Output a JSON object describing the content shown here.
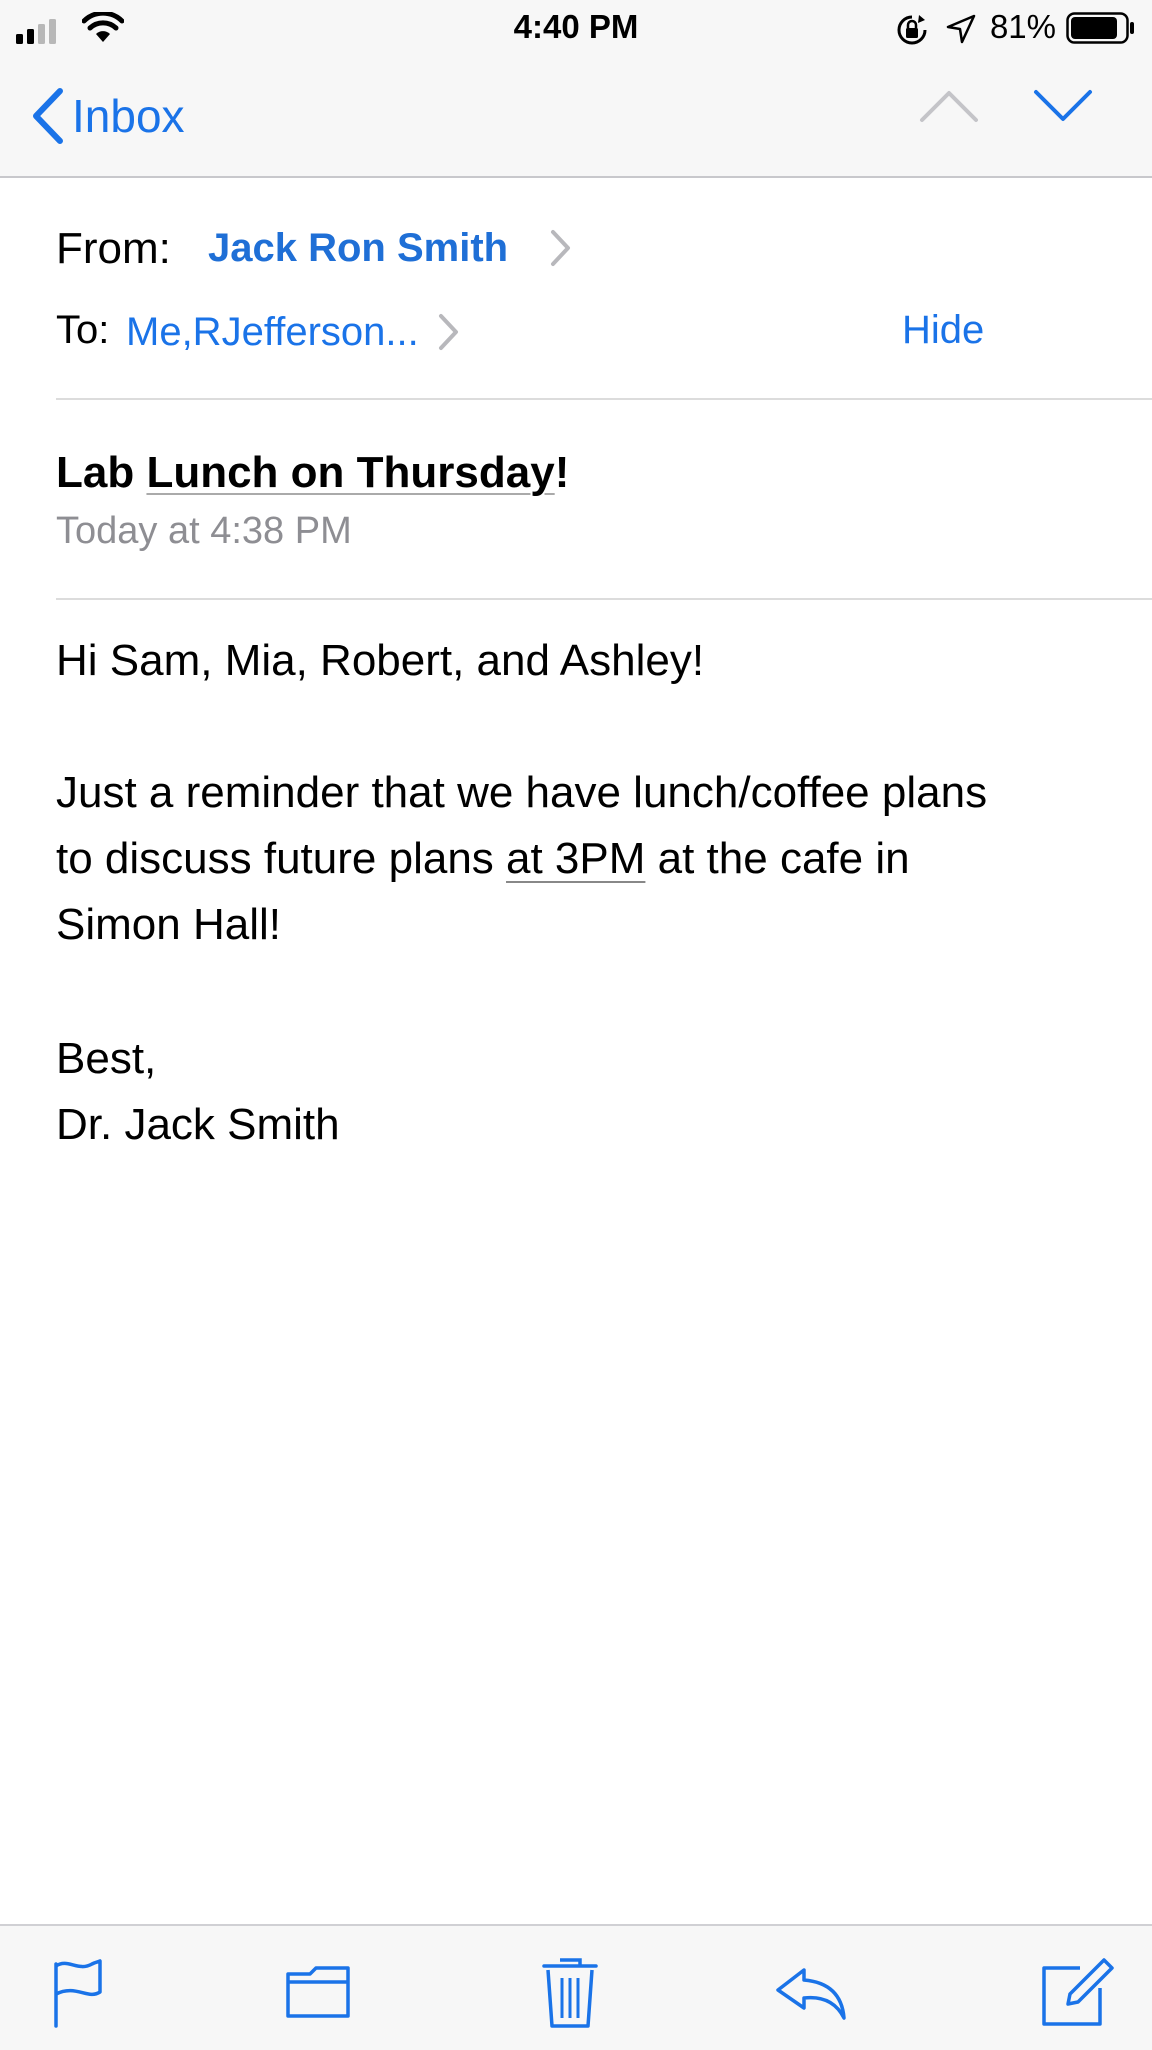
{
  "status_bar": {
    "time": "4:40 PM",
    "battery_percent": "81%",
    "icons": [
      "signal-icon",
      "wifi-icon",
      "rotation-lock-icon",
      "location-icon",
      "battery-icon"
    ]
  },
  "nav": {
    "back_label": "Inbox",
    "prev_icon": "chevron-up-icon",
    "next_icon": "chevron-down-icon"
  },
  "header": {
    "from_label": "From:",
    "sender": "Jack Ron Smith",
    "to_label": "To:",
    "recipients": "Me,RJefferson...",
    "hide_label": "Hide"
  },
  "message": {
    "subject_prefix": "Lab ",
    "subject_linked": "Lunch on Thursday",
    "subject_suffix": "!",
    "date": "Today at 4:38 PM",
    "greeting": "Hi Sam, Mia, Robert, and Ashley!",
    "para_line1": "Just a reminder that we have lunch/coffee plans",
    "para_line2_a": "to discuss future plans ",
    "para_line2_link": "at 3PM",
    "para_line2_b": " at the cafe in",
    "para_line3": "Simon Hall!",
    "signoff": "Best,",
    "signature": "Dr. Jack Smith"
  },
  "toolbar": {
    "items": [
      "flag-icon",
      "folder-icon",
      "trash-icon",
      "reply-icon",
      "compose-icon"
    ]
  },
  "colors": {
    "accent": "#1a73e8",
    "secondary_text": "#8e8e93",
    "bar_background": "#f7f7f7"
  }
}
